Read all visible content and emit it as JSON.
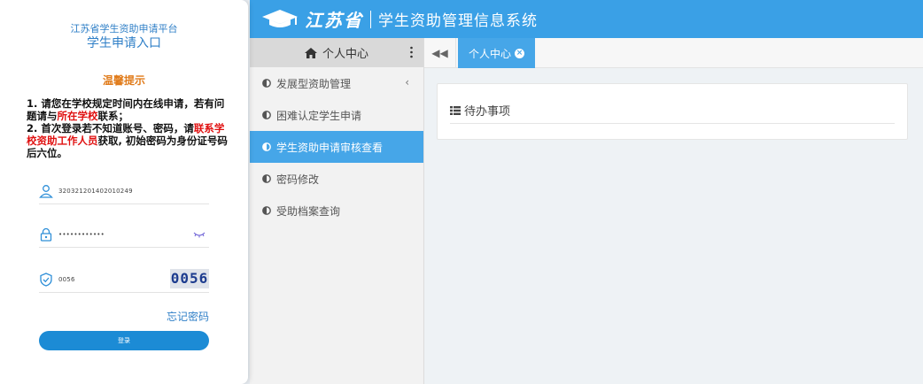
{
  "login": {
    "platform": "江苏省学生资助申请平台",
    "entry": "学生申请入口",
    "tip_title": "温馨提示",
    "notice": {
      "l1a": "1. 请您在学校规定时间内在线申请，若有问题请与",
      "l1b": "所在学校",
      "l1c": "联系；",
      "l2a": "2. 首次登录若不知道账号、密码，请",
      "l2b": "联系学校资助工作人员",
      "l2c": "获取, 初始密码为身份证号码后六位。"
    },
    "username_value": "320321201402010249",
    "password_value": "••••••••••••",
    "captcha_input": "0056",
    "captcha_image": "0056",
    "forgot_label": "忘记密码",
    "login_label": "登录"
  },
  "header": {
    "brand_script": "江苏省",
    "title": "学生资助管理信息系统"
  },
  "sidebar": {
    "title": "个人中心",
    "items": [
      {
        "label": "发展型资助管理"
      },
      {
        "label": "困难认定学生申请"
      },
      {
        "label": "学生资助申请审核查看"
      },
      {
        "label": "密码修改"
      },
      {
        "label": "受助档案查询"
      }
    ]
  },
  "tabs": {
    "active_label": "个人中心"
  },
  "main": {
    "card_title": "待办事项"
  },
  "colors": {
    "accent": "#3aa0e6",
    "active": "#46a6e8",
    "warn": "#e07b1a",
    "danger": "#e01010"
  }
}
